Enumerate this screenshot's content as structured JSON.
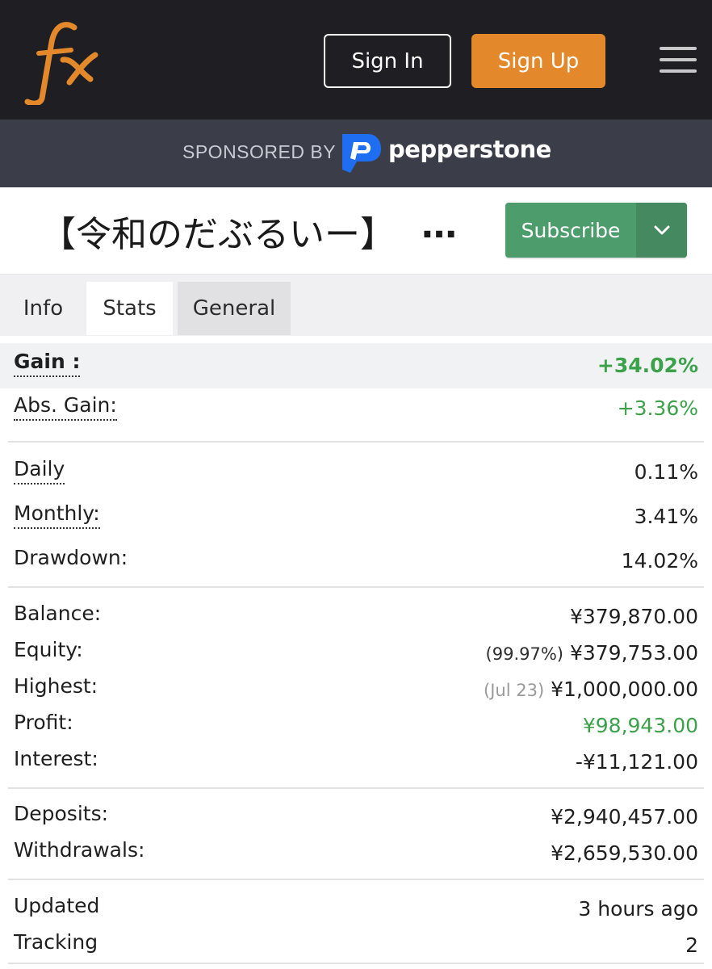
{
  "header": {
    "logo_text": "fx",
    "sign_in": "Sign In",
    "sign_up": "Sign Up",
    "menu_icon": "hamburger-menu-icon",
    "colors": {
      "bar": "#1e1e23",
      "accent": "#e4892b"
    }
  },
  "sponsor": {
    "label": "SPONSORED BY",
    "brand": "pepperstone",
    "brand_icon": "pepperstone-logo-icon",
    "colors": {
      "bar": "#3b3d48",
      "logo": "#1f6df0"
    }
  },
  "system": {
    "title": "【令和のだぶるいー】",
    "title_ellipsis": "…",
    "subscribe": "Subscribe",
    "dropdown_icon": "chevron-down-icon",
    "subscribe_color": "#4d9d6c"
  },
  "tabs": [
    {
      "label": "Info"
    },
    {
      "label": "Stats"
    },
    {
      "label": "General"
    }
  ],
  "stats": {
    "gain": {
      "label": "Gain :",
      "value": "+34.02%"
    },
    "abs_gain": {
      "label": "Abs. Gain:",
      "value": "+3.36%"
    },
    "daily": {
      "label": "Daily",
      "value": "0.11%"
    },
    "monthly": {
      "label": "Monthly:",
      "value": "3.41%"
    },
    "drawdown": {
      "label": "Drawdown:",
      "value": "14.02%"
    },
    "balance": {
      "label": "Balance:",
      "value": "¥379,870.00"
    },
    "equity": {
      "label": "Equity:",
      "prefix": "(99.97%)",
      "value": "¥379,753.00"
    },
    "highest": {
      "label": "Highest:",
      "prefix": "(Jul 23)",
      "value": "¥1,000,000.00"
    },
    "profit": {
      "label": "Profit:",
      "value": "¥98,943.00"
    },
    "interest": {
      "label": "Interest:",
      "value": "-¥11,121.00"
    },
    "deposits": {
      "label": "Deposits:",
      "value": "¥2,940,457.00"
    },
    "withdrawals": {
      "label": "Withdrawals:",
      "value": "¥2,659,530.00"
    },
    "updated": {
      "label": "Updated",
      "value": "3 hours ago"
    },
    "tracking": {
      "label": "Tracking",
      "value": "2"
    }
  },
  "colors": {
    "positive": "#3ca24a"
  }
}
